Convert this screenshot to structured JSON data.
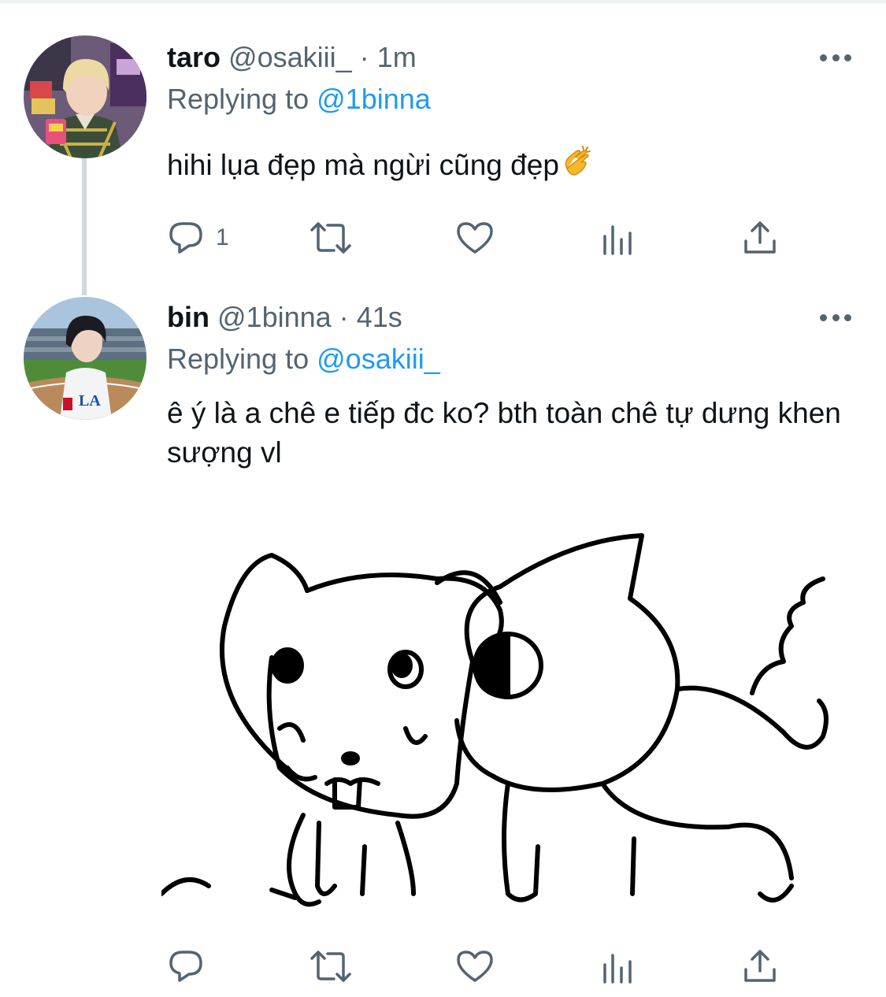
{
  "tweets": [
    {
      "name": "taro",
      "handle": "@osakiii_",
      "separator": "·",
      "time": "1m",
      "replying_label": "Replying to",
      "replying_to": "@1binna",
      "text": "hihi lụa đẹp mà ngừi cũng đẹp",
      "emoji": "clapping-hands-emoji",
      "reply_count": "1"
    },
    {
      "name": "bin",
      "handle": "@1binna",
      "separator": "·",
      "time": "41s",
      "replying_label": "Replying to",
      "replying_to": "@osakiii_",
      "text": "ê ý là a chê e tiếp đc ko? bth toàn chê tự dưng khen sượng vl",
      "reply_count": ""
    }
  ],
  "colors": {
    "accent": "#1d9bf0",
    "secondary_text": "#536471",
    "primary_text": "#0f1419",
    "thread_line": "#cfd9de"
  },
  "icons": [
    "comment-icon",
    "retweet-icon",
    "like-icon",
    "analytics-icon",
    "share-icon",
    "more-icon"
  ]
}
